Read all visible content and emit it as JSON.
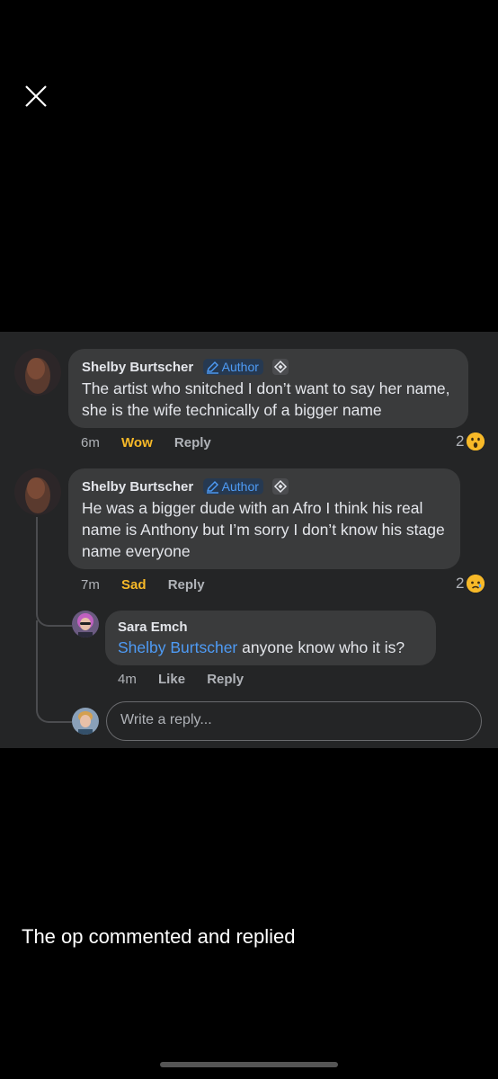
{
  "close": {
    "icon": "close-icon"
  },
  "comments": [
    {
      "author": "Shelby Burtscher",
      "badge": "Author",
      "text": "The artist who snitched I don’t want to say her name, she is the wife technically of a bigger name",
      "time": "6m",
      "reaction_label": "Wow",
      "reply_label": "Reply",
      "reaction_count": "2",
      "reaction_icon": "wow-emoji-icon"
    },
    {
      "author": "Shelby Burtscher",
      "badge": "Author",
      "text": "He was a bigger dude with an Afro I think his real name is Anthony but I’m sorry I don’t know his stage name everyone",
      "time": "7m",
      "reaction_label": "Sad",
      "reply_label": "Reply",
      "reaction_count": "2",
      "reaction_icon": "sad-emoji-icon",
      "replies": [
        {
          "author": "Sara Emch",
          "mention": "Shelby Burtscher",
          "text": " anyone know who it is?",
          "time": "4m",
          "like_label": "Like",
          "reply_label": "Reply"
        }
      ]
    }
  ],
  "reply_input": {
    "placeholder": "Write a reply..."
  },
  "caption": "The op commented and replied",
  "colors": {
    "accent": "#4e9bf5",
    "reaction": "#f7b928",
    "panel": "#242526",
    "bubble": "#3a3b3c"
  }
}
